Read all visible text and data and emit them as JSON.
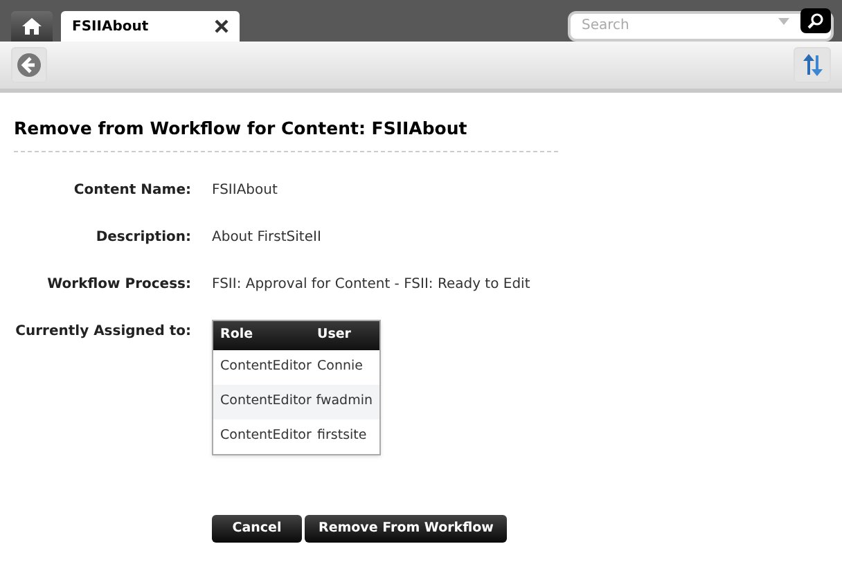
{
  "tabs": [
    {
      "label": "FSIIAbout",
      "selected": true
    }
  ],
  "search": {
    "placeholder": "Search"
  },
  "title": "Remove from Workflow for Content: FSIIAbout",
  "fields": [
    {
      "label": "Content Name:",
      "value": "FSIIAbout"
    },
    {
      "label": "Description:",
      "value": "About FirstSiteII"
    },
    {
      "label": "Workflow Process:",
      "value": "FSII: Approval for Content - FSII: Ready to Edit"
    }
  ],
  "assigned": {
    "label": "Currently Assigned to:",
    "columns": [
      "Role",
      "User"
    ],
    "rows": [
      [
        "ContentEditor",
        "Connie"
      ],
      [
        "ContentEditor",
        "fwadmin"
      ],
      [
        "ContentEditor",
        "firstsite"
      ]
    ]
  },
  "buttons": [
    "Cancel",
    "Remove From Workflow"
  ]
}
